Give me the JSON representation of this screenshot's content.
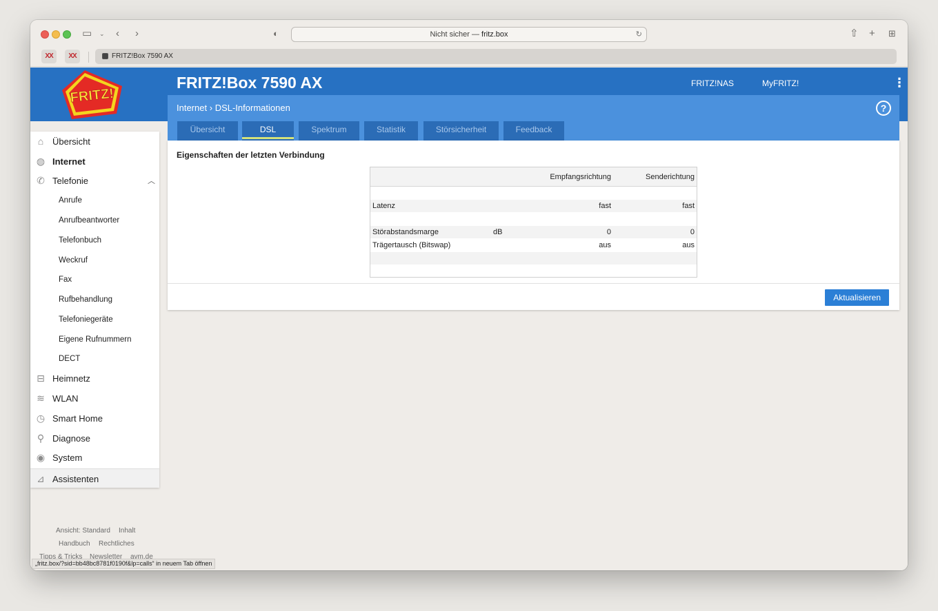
{
  "browser": {
    "url_prefix": "Nicht sicher — ",
    "url_host": "fritz.box",
    "tab_title": "FRITZ!Box 7590 AX",
    "favicon_text": "XX"
  },
  "header": {
    "logo_text": "FRITZ!",
    "title": "FRITZ!Box 7590 AX",
    "nav": [
      "FRITZ!NAS",
      "MyFRITZ!"
    ],
    "help": "?"
  },
  "breadcrumb": {
    "parent": "Internet",
    "separator": "›",
    "current": "DSL-Informationen"
  },
  "tabs": [
    {
      "label": "Übersicht"
    },
    {
      "label": "DSL"
    },
    {
      "label": "Spektrum"
    },
    {
      "label": "Statistik"
    },
    {
      "label": "Störsicherheit"
    },
    {
      "label": "Feedback"
    }
  ],
  "sidebar": {
    "items": [
      {
        "label": "Übersicht"
      },
      {
        "label": "Internet"
      },
      {
        "label": "Telefonie"
      },
      {
        "label": "Anrufe"
      },
      {
        "label": "Anrufbeantworter"
      },
      {
        "label": "Telefonbuch"
      },
      {
        "label": "Weckruf"
      },
      {
        "label": "Fax"
      },
      {
        "label": "Rufbehandlung"
      },
      {
        "label": "Telefoniegeräte"
      },
      {
        "label": "Eigene Rufnummern"
      },
      {
        "label": "DECT"
      },
      {
        "label": "Heimnetz"
      },
      {
        "label": "WLAN"
      },
      {
        "label": "Smart Home"
      },
      {
        "label": "Diagnose"
      },
      {
        "label": "System"
      }
    ],
    "assistants": "Assistenten"
  },
  "footer": {
    "links": [
      "Ansicht: Standard",
      "Inhalt",
      "Handbuch",
      "Rechtliches",
      "Tipps & Tricks",
      "Newsletter",
      "avm.de"
    ],
    "status_text": "„fritz.box/?sid=bb48bc8781f0190f&lp=calls“ in neuem Tab öffnen"
  },
  "content": {
    "section_title": "Eigenschaften der letzten Verbindung",
    "table": {
      "headers": [
        "",
        "",
        "Empfangsrichtung",
        "Senderichtung"
      ],
      "rows": [
        {
          "label": "Latenz",
          "unit": "",
          "down": "fast",
          "up": "fast"
        },
        {
          "label": "Störabstandsmarge",
          "unit": "dB",
          "down": "0",
          "up": "0"
        },
        {
          "label": "Trägertausch (Bitswap)",
          "unit": "",
          "down": "aus",
          "up": "aus"
        }
      ]
    },
    "update_button": "Aktualisieren"
  }
}
